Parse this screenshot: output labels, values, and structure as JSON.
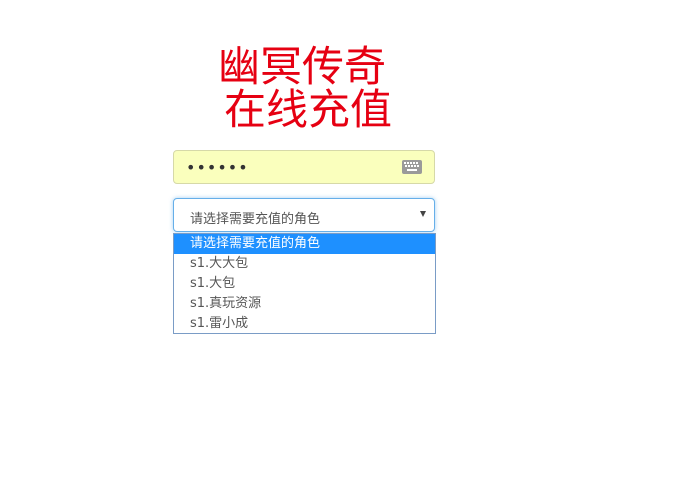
{
  "title": {
    "line1": "幽冥传奇",
    "line2": "在线充值"
  },
  "password": {
    "value": "••••••"
  },
  "role_select": {
    "selected": "请选择需要充值的角色",
    "options": [
      "请选择需要充值的角色",
      "s1.大大包",
      "s1.大包",
      "s1.真玩资源",
      "s1.雷小成"
    ],
    "highlighted_index": 0
  },
  "colors": {
    "title": "#e60012",
    "highlight": "#1e90ff",
    "autofill_bg": "#faffbd"
  },
  "icons": {
    "keyboard": "keyboard-icon"
  }
}
